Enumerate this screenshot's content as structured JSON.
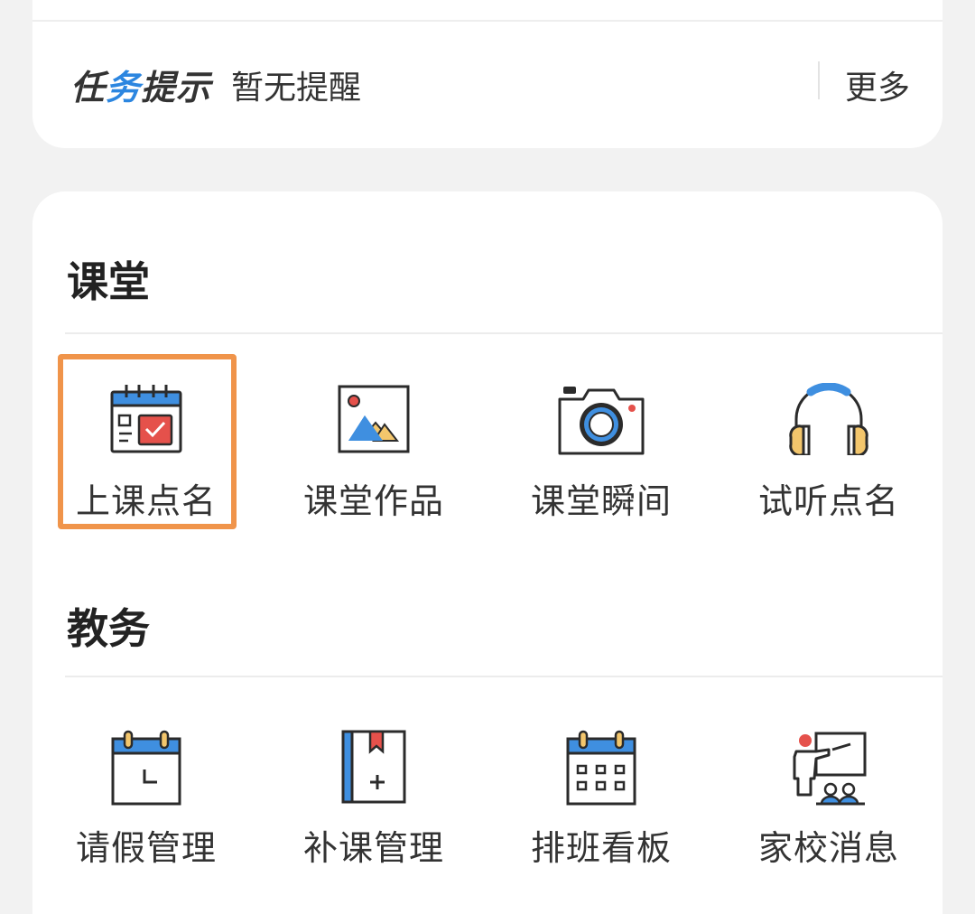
{
  "notice": {
    "brand_prefix": "任",
    "brand_accent": "务",
    "brand_suffix": "提示",
    "text": "暂无提醒",
    "more": "更多"
  },
  "sections": {
    "classroom": {
      "title": "课堂",
      "items": [
        {
          "label": "上课点名",
          "icon": "attendance-calendar-icon"
        },
        {
          "label": "课堂作品",
          "icon": "picture-icon"
        },
        {
          "label": "课堂瞬间",
          "icon": "camera-icon"
        },
        {
          "label": "试听点名",
          "icon": "headphones-icon"
        }
      ]
    },
    "academic": {
      "title": "教务",
      "items": [
        {
          "label": "请假管理",
          "icon": "leave-calendar-icon"
        },
        {
          "label": "补课管理",
          "icon": "bookmark-book-icon"
        },
        {
          "label": "排班看板",
          "icon": "schedule-calendar-icon"
        },
        {
          "label": "家校消息",
          "icon": "teacher-presentation-icon"
        }
      ]
    }
  },
  "colors": {
    "blue": "#3f8fe0",
    "red": "#e5514b",
    "yellow": "#f3c66c",
    "outline": "#2b2b2b",
    "highlight": "#f0944a"
  }
}
